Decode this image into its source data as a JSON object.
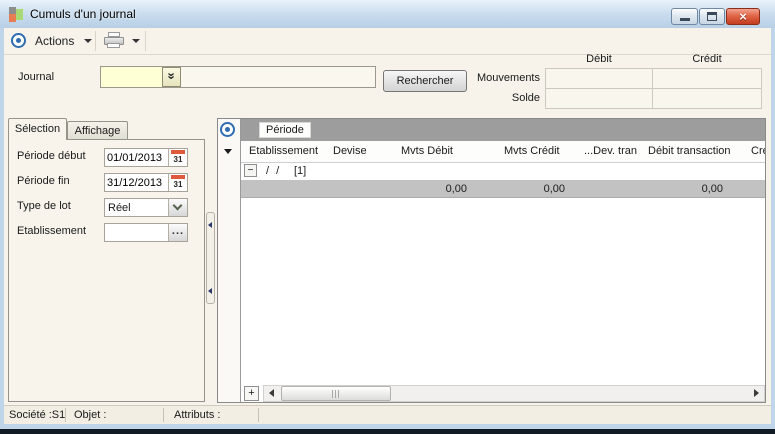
{
  "window": {
    "title": "Cumuls d'un journal"
  },
  "icons": {
    "close_glyph": "×",
    "journal_lookup_glyph": "»"
  },
  "toolbar": {
    "actions_label": "Actions"
  },
  "search": {
    "journal_label": "Journal",
    "journal_value": "",
    "search_button_label": "Rechercher",
    "debit_header": "Débit",
    "credit_header": "Crédit",
    "mouvements_label": "Mouvements",
    "solde_label": "Solde",
    "mouvements_debit": "",
    "mouvements_credit": "",
    "solde_debit": "",
    "solde_credit": ""
  },
  "selection_panel": {
    "tabs": [
      {
        "label": "Sélection"
      },
      {
        "label": "Affichage"
      }
    ],
    "fields": [
      {
        "label": "Période début",
        "value": "01/01/2013"
      },
      {
        "label": "Période fin",
        "value": "31/12/2013"
      },
      {
        "label": "Type de lot",
        "value": "Réel"
      },
      {
        "label": "Etablissement",
        "value": ""
      }
    ],
    "calendar_day": "31",
    "ellipsis_label": "..."
  },
  "grid": {
    "group_chip": "Période",
    "columns": [
      "Etablissement",
      "Devise",
      "Mvts Débit",
      "Mvts Crédit",
      "...Dev. tran",
      "Débit transaction",
      "Cré"
    ],
    "group_row": {
      "collapse_glyph": "−",
      "date_text": "/ /",
      "count_text": "[1]"
    },
    "summary": [
      "0,00",
      "0,00",
      "0,00"
    ],
    "add_button_label": "+"
  },
  "status_bar": {
    "cells": [
      "Société :S1",
      "Objet :",
      "Attributs :",
      ""
    ]
  },
  "colors": {
    "accent_blue": "#2f6cb0",
    "close_red": "#c43d20",
    "field_yellow": "#ffffd6",
    "calendar_red": "#dd5a3c",
    "group_bar_gray": "#9d9d9d",
    "summary_gray": "#c2c2c2"
  }
}
